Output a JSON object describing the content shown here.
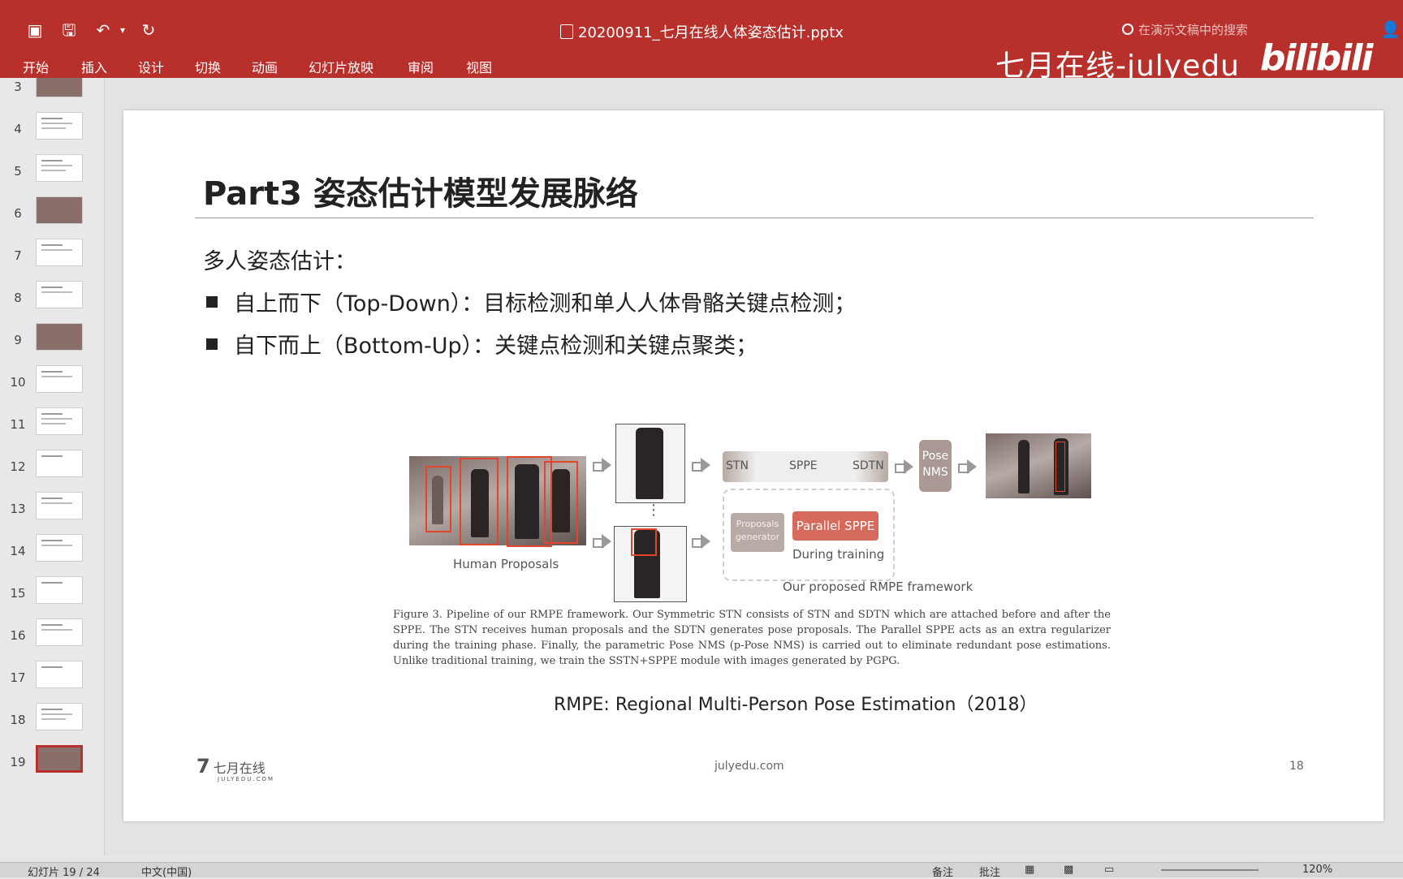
{
  "app": {
    "file_name": "20200911_七月在线人体姿态估计.pptx",
    "search_placeholder": "在演示文稿中的搜索",
    "ribbon_tabs": [
      "开始",
      "插入",
      "设计",
      "切换",
      "动画",
      "幻灯片放映",
      "审阅",
      "视图"
    ],
    "brand_overlay": "七月在线-julyedu",
    "watermark": "bilibili"
  },
  "thumbnails": [
    {
      "num": "3",
      "dark": true
    },
    {
      "num": "4",
      "dark": false
    },
    {
      "num": "5",
      "dark": false
    },
    {
      "num": "6",
      "dark": true
    },
    {
      "num": "7",
      "dark": false
    },
    {
      "num": "8",
      "dark": false
    },
    {
      "num": "9",
      "dark": true
    },
    {
      "num": "10",
      "dark": false
    },
    {
      "num": "11",
      "dark": false
    },
    {
      "num": "12",
      "dark": false
    },
    {
      "num": "13",
      "dark": false
    },
    {
      "num": "14",
      "dark": false
    },
    {
      "num": "15",
      "dark": false
    },
    {
      "num": "16",
      "dark": false
    },
    {
      "num": "17",
      "dark": false
    },
    {
      "num": "18",
      "dark": false
    },
    {
      "num": "19",
      "dark": true,
      "selected": true
    }
  ],
  "slide": {
    "title": "Part3 姿态估计模型发展脉络",
    "subheading": "多人姿态估计：",
    "bullets": [
      "自上而下（Top-Down）：目标检测和单人人体骨骼关键点检测；",
      "自下而上（Bottom-Up）：关键点检测和关键点聚类；"
    ],
    "figure": {
      "human_proposals": "Human Proposals",
      "stn": "STN",
      "sppe": "SPPE",
      "sdtn": "SDTN",
      "pose_nms": "Pose NMS",
      "proposals_generator": "Proposals generator",
      "parallel_sppe": "Parallel SPPE",
      "during_training": "During training",
      "framework": "Our proposed RMPE framework"
    },
    "caption": "Figure 3. Pipeline of our RMPE framework. Our Symmetric STN consists of STN and SDTN which are attached before and after the SPPE. The STN receives human proposals and the SDTN generates pose proposals. The Parallel SPPE acts as an extra regularizer during the training phase. Finally, the parametric Pose NMS (p-Pose NMS) is carried out to eliminate redundant pose estimations. Unlike traditional training, we train the SSTN+SPPE module with images generated by PGPG.",
    "citation": "RMPE: Regional Multi-Person Pose Estimation（2018）",
    "footer_logo": "七月在线",
    "footer_logo_sub": "JULYEDU.COM",
    "footer_url": "julyedu.com",
    "page_number": "18"
  },
  "statusbar": {
    "slide_counter": "幻灯片 19 / 24",
    "language": "中文(中国)",
    "notes": "备注",
    "comments": "批注",
    "zoom": "120%"
  }
}
